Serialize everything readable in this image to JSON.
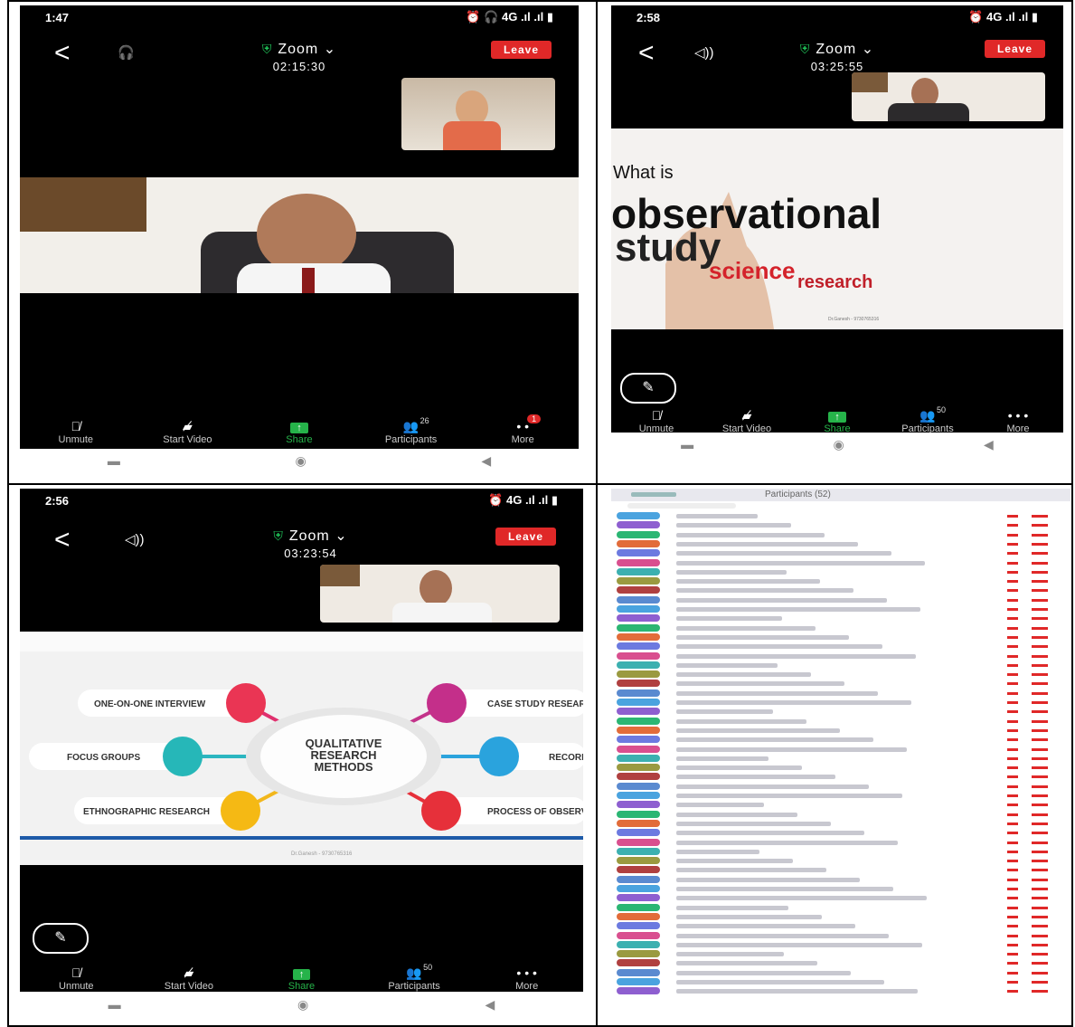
{
  "panels": [
    {
      "clock": "1:47",
      "zoom_title": "Zoom",
      "timer": "02:15:30",
      "leave_label": "Leave",
      "participants_count": "26",
      "more_badge": "1"
    },
    {
      "clock": "2:58",
      "zoom_title": "Zoom",
      "timer": "03:25:55",
      "leave_label": "Leave",
      "participants_count": "50"
    },
    {
      "clock": "2:56",
      "zoom_title": "Zoom",
      "timer": "03:23:54",
      "leave_label": "Leave",
      "participants_count": "50"
    }
  ],
  "toolbar": {
    "unmute": "Unmute",
    "start_video": "Start Video",
    "share": "Share",
    "participants": "Participants",
    "more": "More"
  },
  "slide_observational": {
    "line1": "What is",
    "line2": "observational",
    "line3": "study",
    "line4": "science",
    "line5": "research",
    "credit": "Dr.Ganesh - 9730765316"
  },
  "slide_qualitative": {
    "center": [
      "QUALITATIVE",
      "RESEARCH",
      "METHODS"
    ],
    "items": [
      "ONE-ON-ONE INTERVIEW",
      "FOCUS GROUPS",
      "ETHNOGRAPHIC RESEARCH",
      "CASE STUDY RESEARI",
      "RECORI",
      "PROCESS OF OBSERV"
    ],
    "credit": "Dr.Ganesh - 9730765316"
  },
  "participants_panel": {
    "title": "Participants (52)",
    "rows": 52
  },
  "colors": {
    "leave": "#e02828",
    "share": "#26b34a",
    "shield": "#1fc157"
  }
}
